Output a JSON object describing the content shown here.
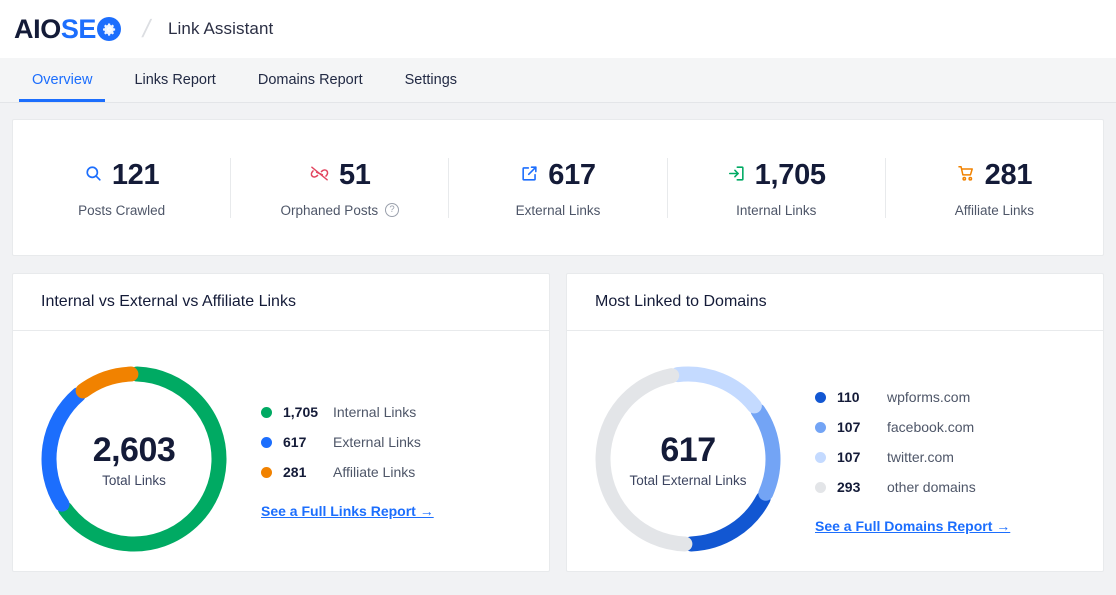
{
  "header": {
    "logo": {
      "part1": "AIO",
      "part2": "SE",
      "part3_icon": "gear-icon"
    },
    "separator": "/",
    "title": "Link Assistant"
  },
  "tabs": [
    {
      "label": "Overview",
      "active": true
    },
    {
      "label": "Links Report",
      "active": false
    },
    {
      "label": "Domains Report",
      "active": false
    },
    {
      "label": "Settings",
      "active": false
    }
  ],
  "stats": [
    {
      "icon": "search-icon",
      "value": "121",
      "label": "Posts Crawled",
      "color": "#1c6efd",
      "help": ""
    },
    {
      "icon": "broken-link-icon",
      "value": "51",
      "label": "Orphaned Posts",
      "color": "#df2a4a",
      "help": "?"
    },
    {
      "icon": "external-link-icon",
      "value": "617",
      "label": "External Links",
      "color": "#1c6efd",
      "help": ""
    },
    {
      "icon": "internal-link-icon",
      "value": "1,705",
      "label": "Internal Links",
      "color": "#00aa63",
      "help": ""
    },
    {
      "icon": "cart-icon",
      "value": "281",
      "label": "Affiliate Links",
      "color": "#f18200",
      "help": ""
    }
  ],
  "links_card": {
    "title": "Internal vs External vs Affiliate Links",
    "total": "2,603",
    "total_label": "Total Links",
    "legend": [
      {
        "value": "1,705",
        "name": "Internal Links",
        "color": "#00aa63"
      },
      {
        "value": "617",
        "name": "External Links",
        "color": "#1c6efd"
      },
      {
        "value": "281",
        "name": "Affiliate Links",
        "color": "#f18200"
      }
    ],
    "link_label": "See a Full Links Report →"
  },
  "domains_card": {
    "title": "Most Linked to Domains",
    "total": "617",
    "total_label": "Total External Links",
    "legend": [
      {
        "value": "110",
        "name": "wpforms.com",
        "color": "#1257d2"
      },
      {
        "value": "107",
        "name": "facebook.com",
        "color": "#73a4f5"
      },
      {
        "value": "107",
        "name": "twitter.com",
        "color": "#c4daff"
      },
      {
        "value": "293",
        "name": "other domains",
        "color": "#e3e5e8"
      }
    ],
    "link_label": "See a Full Domains Report →"
  },
  "chart_data": [
    {
      "type": "pie",
      "title": "Internal vs External vs Affiliate Links",
      "categories": [
        "Internal Links",
        "External Links",
        "Affiliate Links"
      ],
      "values": [
        1705,
        617,
        281
      ],
      "colors": [
        "#00aa63",
        "#1c6efd",
        "#f18200"
      ],
      "total": 2603,
      "center_label": "Total Links",
      "legend_position": "right",
      "donut": true
    },
    {
      "type": "pie",
      "title": "Most Linked to Domains",
      "categories": [
        "wpforms.com",
        "facebook.com",
        "twitter.com",
        "other domains"
      ],
      "values": [
        110,
        107,
        107,
        293
      ],
      "colors": [
        "#1257d2",
        "#73a4f5",
        "#c4daff",
        "#e3e5e8"
      ],
      "total": 617,
      "center_label": "Total External Links",
      "legend_position": "right",
      "donut": true
    }
  ]
}
